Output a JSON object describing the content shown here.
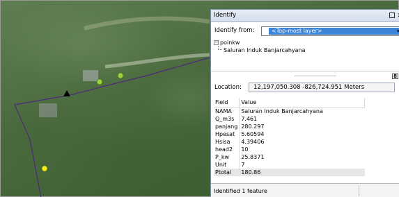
{
  "map": {
    "features": [
      {
        "name": "green-point-1",
        "color": "#9bd13a"
      },
      {
        "name": "green-point-2",
        "color": "#9bd13a"
      },
      {
        "name": "yellow-point",
        "color": "#f2ee1a"
      },
      {
        "name": "identified-triangle",
        "color": "#000000"
      }
    ],
    "line_color": "#4b2a7a"
  },
  "identify": {
    "title": "Identify",
    "from_label": "Identify from:",
    "from_value": "<Top-most layer>",
    "tree": {
      "layer": "poinkw",
      "feature": "Saluran Induk Banjarcahyana"
    },
    "location_label": "Location:",
    "location_value": "12,197,050.308  -826,724.951 Meters",
    "table": {
      "headers": [
        "Field",
        "Value"
      ],
      "rows": [
        {
          "field": "NAMA",
          "value": "Saluran Induk Banjarcahyana"
        },
        {
          "field": "Q_m3s",
          "value": "7.461"
        },
        {
          "field": "panjang",
          "value": "280.297"
        },
        {
          "field": "Hpesat",
          "value": "5.60594"
        },
        {
          "field": "Hsisa",
          "value": "4.39406"
        },
        {
          "field": "head2",
          "value": "10"
        },
        {
          "field": "P_kw",
          "value": "25.8371"
        },
        {
          "field": "Unit",
          "value": "7"
        },
        {
          "field": "Ptotal",
          "value": "180.86"
        }
      ]
    },
    "status": "Identified 1 feature",
    "icons": [
      "minus-expander-icon",
      "restore-icon",
      "close-icon",
      "dropdown-arrow-icon",
      "toggle-button-icon"
    ]
  }
}
